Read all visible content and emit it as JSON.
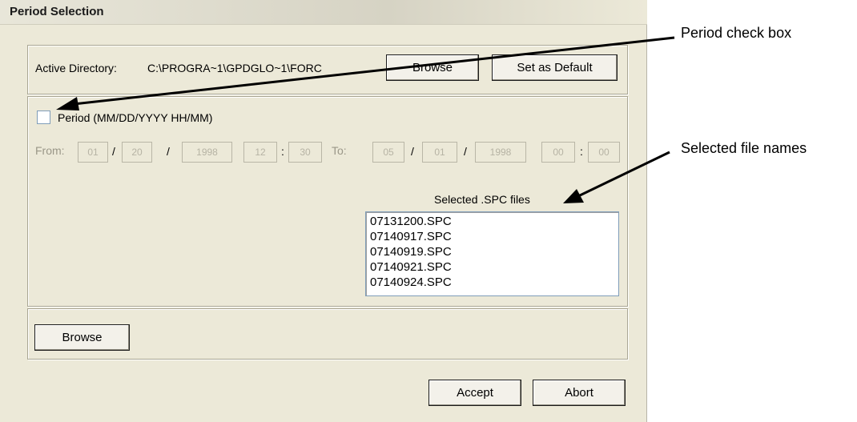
{
  "dialog": {
    "title": "Period Selection"
  },
  "directory": {
    "label": "Active Directory:",
    "path": "C:\\PROGRA~1\\GPDGLO~1\\FORC",
    "browse_label": "Browse",
    "default_label": "Set as Default"
  },
  "period": {
    "checkbox_label": "Period (MM/DD/YYYY HH/MM)",
    "checked": false,
    "from_label": "From:",
    "to_label": "To:",
    "from": {
      "month": "01",
      "day": "20",
      "year": "1998",
      "hour": "12",
      "minute": "30"
    },
    "to": {
      "month": "05",
      "day": "01",
      "year": "1998",
      "hour": "00",
      "minute": "00"
    },
    "date_sep": "/",
    "time_sep": ":"
  },
  "files": {
    "label": "Selected .SPC files",
    "items": [
      "07131200.SPC",
      "07140917.SPC",
      "07140919.SPC",
      "07140921.SPC",
      "07140924.SPC"
    ],
    "browse_label": "Browse"
  },
  "actions": {
    "accept_label": "Accept",
    "abort_label": "Abort"
  },
  "annotations": {
    "period_checkbox": "Period check box",
    "selected_files": "Selected file names"
  }
}
